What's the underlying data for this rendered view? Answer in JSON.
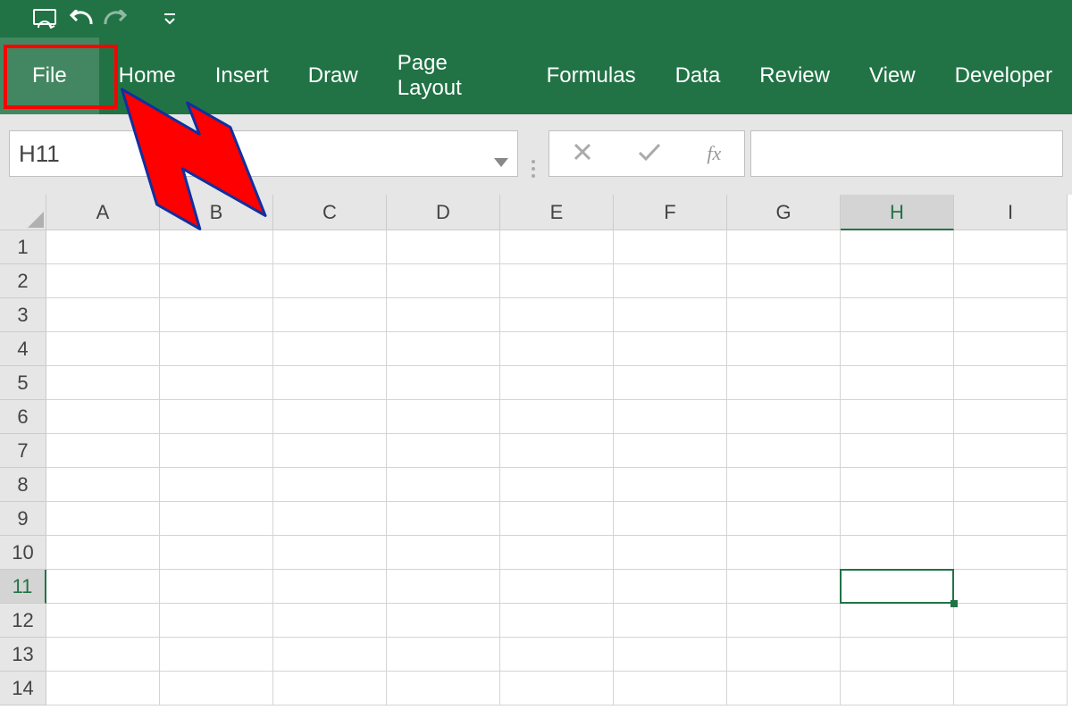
{
  "quickAccess": {
    "buttons": [
      "autosave",
      "undo",
      "redo",
      "customize"
    ]
  },
  "ribbon": {
    "tabs": [
      "File",
      "Home",
      "Insert",
      "Draw",
      "Page Layout",
      "Formulas",
      "Data",
      "Review",
      "View",
      "Developer"
    ],
    "highlighted": "File"
  },
  "formulaBar": {
    "nameBoxValue": "H11",
    "fxLabel": "fx",
    "formulaValue": ""
  },
  "grid": {
    "columns": [
      "A",
      "B",
      "C",
      "D",
      "E",
      "F",
      "G",
      "H",
      "I"
    ],
    "rowCount": 14,
    "selected": {
      "col": "H",
      "row": 11,
      "colIndex": 7,
      "rowIndex": 10
    }
  },
  "annotation": {
    "type": "red-arrow",
    "target": "file-tab"
  },
  "colors": {
    "ribbonGreen": "#217346",
    "highlightRed": "#ff0000"
  }
}
